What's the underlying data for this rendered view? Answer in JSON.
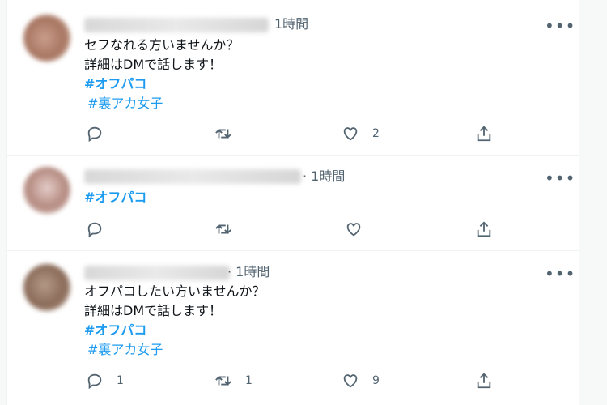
{
  "tweets": [
    {
      "time": "1時間",
      "text_lines": [
        "セフなれる方いませんか？",
        "詳細はDMで話します！"
      ],
      "hashtags": [
        "#オフパコ",
        "#裏アカ女子"
      ],
      "reply_count": "",
      "retweet_count": "",
      "like_count": "2"
    },
    {
      "time": "· 1時間",
      "text_lines": [],
      "hashtags": [
        "#オフパコ"
      ],
      "reply_count": "",
      "retweet_count": "",
      "like_count": ""
    },
    {
      "time": "· 1時間",
      "text_lines": [
        "オフパコしたい方いませんか？",
        "詳細はDMで話します！"
      ],
      "hashtags": [
        "#オフパコ",
        "#裏アカ女子"
      ],
      "reply_count": "1",
      "retweet_count": "1",
      "like_count": "9"
    }
  ],
  "icons": {
    "more": "more-horizontal-icon",
    "reply": "reply-icon",
    "retweet": "retweet-icon",
    "like": "heart-icon",
    "share": "share-icon"
  },
  "colors": {
    "hashtag": "#1d9bf0",
    "secondary_text": "#536471",
    "divider": "#eff3f4"
  }
}
